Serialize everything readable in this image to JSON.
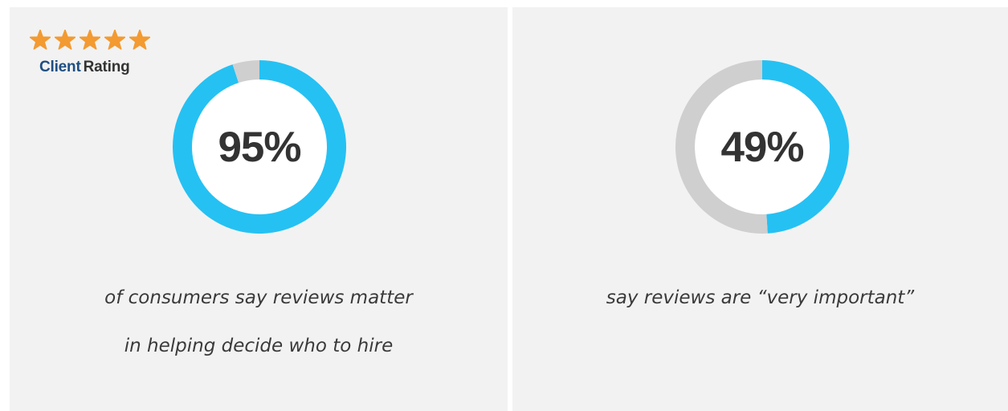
{
  "rating": {
    "stars": 5,
    "star_color": "#f39a31",
    "label_word1": "Client",
    "label_word2": "Rating"
  },
  "chart_data": [
    {
      "type": "pie",
      "value": 95,
      "value_label": "95%",
      "slices": [
        {
          "label": "",
          "value": 95,
          "color": "#25c1f3"
        },
        {
          "label": "",
          "value": 5,
          "color": "#cfcfcf"
        }
      ],
      "caption_lines": [
        "of consumers say reviews matter",
        "in helping decide who to hire"
      ]
    },
    {
      "type": "pie",
      "value": 49,
      "value_label": "49%",
      "slices": [
        {
          "label": "",
          "value": 49,
          "color": "#25c1f3"
        },
        {
          "label": "",
          "value": 51,
          "color": "#cfcfcf"
        }
      ],
      "caption_lines": [
        "say reviews are “very important”"
      ]
    }
  ]
}
